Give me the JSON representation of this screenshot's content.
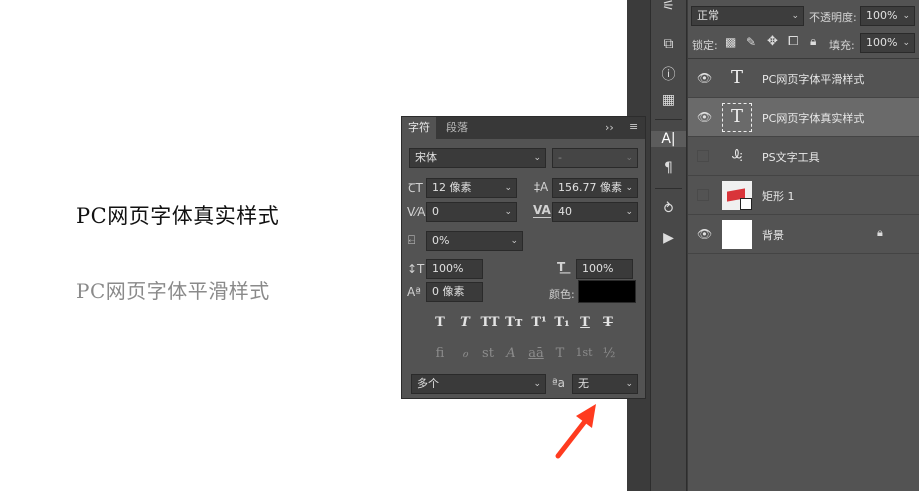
{
  "canvas": {
    "sample_real": "PC网页字体真实样式",
    "sample_smooth": "PC网页字体平滑样式"
  },
  "char_panel": {
    "tabs": [
      "字符",
      "段落"
    ],
    "menu_icon": "double-chevron-icon",
    "font_family": "宋体",
    "font_style": "-",
    "font_size": "12 像素",
    "leading": "156.77 像素",
    "kerning": "0",
    "tracking": "40",
    "tsume": "0%",
    "vertical_scale": "100%",
    "horizontal_scale": "100%",
    "baseline_shift": "0 像素",
    "color_label": "颜色:",
    "color_value": "#000000",
    "style_glyphs": [
      "T",
      "T",
      "TT",
      "Tт",
      "T¹",
      "T₁",
      "T",
      "T"
    ],
    "opentype_glyphs": [
      "fi",
      "ℴ",
      "st",
      "A",
      "aā",
      "T",
      "1st",
      "½"
    ],
    "language": "多个",
    "aa_label": "ªa",
    "antialias": "无"
  },
  "layers_panel": {
    "blend_mode": "正常",
    "opacity_label": "不透明度:",
    "opacity": "100%",
    "lock_label": "锁定:",
    "fill_label": "填充:",
    "fill": "100%",
    "layers": [
      {
        "name": "PC网页字体平滑样式",
        "visible": true,
        "type": "text"
      },
      {
        "name": "PC网页字体真实样式",
        "visible": true,
        "type": "text",
        "selected": true
      },
      {
        "name": "PS文字工具",
        "visible": false,
        "type": "warp-text"
      },
      {
        "name": "矩形 1",
        "visible": false,
        "type": "shape"
      },
      {
        "name": "背景",
        "visible": true,
        "type": "background",
        "locked": true
      }
    ]
  },
  "colors": {
    "panel_bg": "#535353",
    "panel_dark": "#383838",
    "arrow": "#ff3b1f",
    "shape_red": "#d9343a"
  }
}
